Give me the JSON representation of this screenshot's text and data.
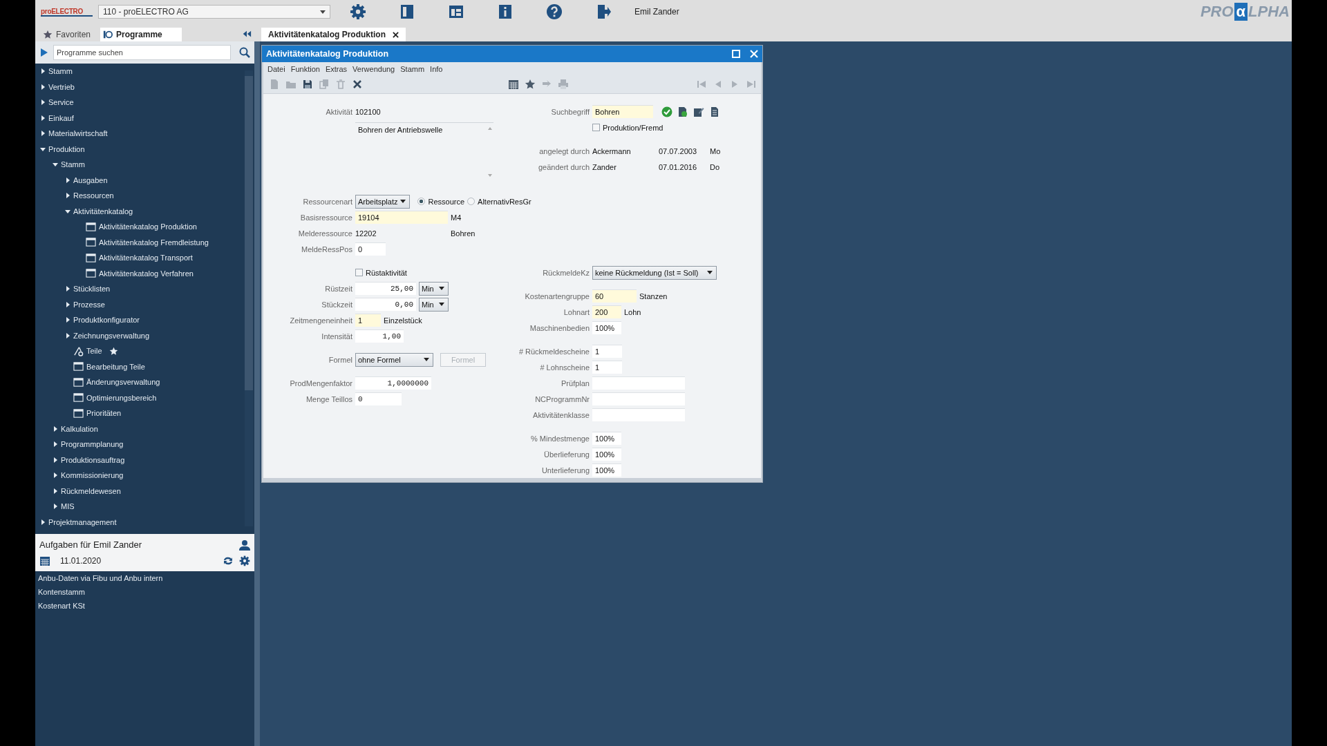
{
  "top_bar": {
    "logo": "proELECTRO",
    "company": "110 - proELECTRO AG",
    "user": "Emil Zander",
    "brand": {
      "prefix": "PRO",
      "mark": "α",
      "suffix": "LPHA"
    }
  },
  "sidebar": {
    "tabs": [
      {
        "label": "Favoriten",
        "selected": false
      },
      {
        "label": "Programme",
        "selected": true
      }
    ],
    "search": {
      "placeholder": "Programme suchen"
    },
    "tree": [
      {
        "label": "Stamm",
        "kind": "folder",
        "expanded": false
      },
      {
        "label": "Vertrieb",
        "kind": "folder",
        "expanded": false
      },
      {
        "label": "Service",
        "kind": "folder",
        "expanded": false
      },
      {
        "label": "Einkauf",
        "kind": "folder",
        "expanded": false
      },
      {
        "label": "Materialwirtschaft",
        "kind": "folder",
        "expanded": false
      },
      {
        "label": "Produktion",
        "kind": "folder",
        "expanded": true,
        "children": [
          {
            "label": "Stamm",
            "kind": "folder",
            "expanded": true,
            "children": [
              {
                "label": "Ausgaben",
                "kind": "folder",
                "expanded": false
              },
              {
                "label": "Ressourcen",
                "kind": "folder",
                "expanded": false
              },
              {
                "label": "Aktivitätenkatalog",
                "kind": "folder",
                "expanded": true,
                "children": [
                  {
                    "label": "Aktivitätenkatalog Produktion",
                    "kind": "program",
                    "favorite": false
                  },
                  {
                    "label": "Aktivitätenkatalog Fremdleistung",
                    "kind": "program",
                    "favorite": false
                  },
                  {
                    "label": "Aktivitätenkatalog Transport",
                    "kind": "program",
                    "favorite": false
                  },
                  {
                    "label": "Aktivitätenkatalog Verfahren",
                    "kind": "program",
                    "favorite": false
                  }
                ]
              },
              {
                "label": "Stücklisten",
                "kind": "folder",
                "expanded": false
              },
              {
                "label": "Prozesse",
                "kind": "folder",
                "expanded": false
              },
              {
                "label": "Produktkonfigurator",
                "kind": "folder",
                "expanded": false
              },
              {
                "label": "Zeichnungsverwaltung",
                "kind": "folder",
                "expanded": false
              },
              {
                "label": "Teile",
                "kind": "tool",
                "favorite": true
              },
              {
                "label": "Bearbeitung Teile",
                "kind": "program",
                "favorite": false
              },
              {
                "label": "Änderungsverwaltung",
                "kind": "program",
                "favorite": false
              },
              {
                "label": "Optimierungsbereich",
                "kind": "program",
                "favorite": false
              },
              {
                "label": "Prioritäten",
                "kind": "program",
                "favorite": false
              }
            ]
          },
          {
            "label": "Kalkulation",
            "kind": "folder",
            "expanded": false
          },
          {
            "label": "Programmplanung",
            "kind": "folder",
            "expanded": false
          },
          {
            "label": "Produktionsauftrag",
            "kind": "folder",
            "expanded": false
          },
          {
            "label": "Kommissionierung",
            "kind": "folder",
            "expanded": false
          },
          {
            "label": "Rückmeldewesen",
            "kind": "folder",
            "expanded": false
          },
          {
            "label": "MIS",
            "kind": "folder",
            "expanded": false
          }
        ]
      },
      {
        "label": "Projektmanagement",
        "kind": "folder",
        "expanded": false
      }
    ],
    "tasks": {
      "title": "Aufgaben für Emil Zander",
      "date": "11.01.2020",
      "items": [
        "Anbu-Daten via Fibu und Anbu intern",
        "Kontenstamm",
        "Kostenart KSt"
      ]
    }
  },
  "document_tabs": [
    {
      "label": "Aktivitätenkatalog Produktion",
      "selected": true
    }
  ],
  "window": {
    "title": "Aktivitätenkatalog Produktion",
    "menu": [
      "Datei",
      "Funktion",
      "Extras",
      "Verwendung",
      "Stamm",
      "Info"
    ],
    "form": {
      "header_left": [
        [
          {
            "label": "Aktivität",
            "controls": [
              {
                "kind": "text",
                "value": "102100"
              }
            ]
          },
          {
            "controls": [
              {
                "kind": "memo",
                "value": "Bohren der Antriebswelle"
              }
            ]
          }
        ]
      ],
      "header_right": [
        [
          {
            "label": "Suchbegriff",
            "controls": [
              {
                "kind": "field",
                "value": "Bohren",
                "highlighted": true
              }
            ]
          },
          {
            "controls": [
              {
                "kind": "checkbox",
                "label": "Produktion/Fremd",
                "checked": false
              }
            ]
          }
        ],
        [
          {
            "label": "angelegt durch",
            "controls": [
              {
                "kind": "text",
                "value": "Ackermann"
              },
              {
                "kind": "text",
                "value": "07.07.2003"
              },
              {
                "kind": "text",
                "value": "Mo"
              }
            ]
          },
          {
            "label": "geändert durch",
            "controls": [
              {
                "kind": "text",
                "value": "Zander"
              },
              {
                "kind": "text",
                "value": "07.01.2016"
              },
              {
                "kind": "text",
                "value": "Do"
              }
            ]
          }
        ]
      ],
      "resource": [
        [
          {
            "label": "Ressourcenart",
            "controls": [
              {
                "kind": "select",
                "value": "Arbeitsplatz"
              },
              {
                "kind": "radio",
                "label": "Ressource",
                "selected": true
              },
              {
                "kind": "radio",
                "label": "AlternativResGr",
                "selected": false
              }
            ]
          },
          {
            "label": "Basisressource",
            "controls": [
              {
                "kind": "field",
                "value": "19104",
                "highlighted": true
              },
              {
                "kind": "text",
                "value": "M4"
              }
            ]
          },
          {
            "label": "Melderessource",
            "controls": [
              {
                "kind": "text",
                "value": "12202"
              },
              {
                "kind": "text",
                "value": "Bohren"
              }
            ]
          },
          {
            "label": "MeldeRessPos",
            "controls": [
              {
                "kind": "field",
                "value": "0",
                "highlighted": false
              }
            ]
          }
        ]
      ],
      "left": [
        [
          {
            "controls": [
              {
                "kind": "checkbox",
                "label": "Rüstaktivität",
                "checked": false
              }
            ]
          },
          {
            "label": "Rüstzeit",
            "controls": [
              {
                "kind": "field",
                "value": "25,00",
                "highlighted": false
              },
              {
                "kind": "select",
                "value": "Min"
              }
            ]
          },
          {
            "label": "Stückzeit",
            "controls": [
              {
                "kind": "field",
                "value": "0,00",
                "highlighted": false
              },
              {
                "kind": "select",
                "value": "Min"
              }
            ]
          },
          {
            "label": "Zeitmengeneinheit",
            "controls": [
              {
                "kind": "field",
                "value": "1",
                "highlighted": true
              },
              {
                "kind": "text",
                "value": "Einzelstück"
              }
            ]
          },
          {
            "label": "Intensität",
            "controls": [
              {
                "kind": "field",
                "value": "1,00",
                "highlighted": false
              }
            ]
          }
        ],
        [
          {
            "label": "Formel",
            "controls": [
              {
                "kind": "select",
                "value": "ohne Formel"
              },
              {
                "kind": "button",
                "label": "Formel",
                "disabled": true
              }
            ]
          }
        ],
        [
          {
            "label": "ProdMengenfaktor",
            "controls": [
              {
                "kind": "field",
                "value": "1,0000000",
                "highlighted": false
              }
            ]
          },
          {
            "label": "Menge Teillos",
            "controls": [
              {
                "kind": "field",
                "value": "0",
                "highlighted": false
              }
            ]
          }
        ]
      ],
      "right": [
        [
          {
            "label": "RückmeldeKz",
            "controls": [
              {
                "kind": "select",
                "value": "keine Rückmeldung (Ist = Soll)"
              }
            ]
          }
        ],
        [
          {
            "label": "Kostenartengruppe",
            "controls": [
              {
                "kind": "field",
                "value": "60",
                "highlighted": true
              },
              {
                "kind": "text",
                "value": "Stanzen"
              }
            ]
          },
          {
            "label": "Lohnart",
            "controls": [
              {
                "kind": "field",
                "value": "200",
                "highlighted": true
              },
              {
                "kind": "text",
                "value": "Lohn"
              }
            ]
          },
          {
            "label": "Maschinenbedien",
            "controls": [
              {
                "kind": "field",
                "value": "100%",
                "highlighted": false
              }
            ]
          }
        ],
        [
          {
            "label": "# Rückmeldescheine",
            "controls": [
              {
                "kind": "field",
                "value": "1",
                "highlighted": false
              }
            ]
          },
          {
            "label": "# Lohnscheine",
            "controls": [
              {
                "kind": "field",
                "value": "1",
                "highlighted": false
              }
            ]
          },
          {
            "label": "Prüfplan",
            "controls": [
              {
                "kind": "field",
                "highlighted": false
              }
            ]
          },
          {
            "label": "NCProgrammNr",
            "controls": [
              {
                "kind": "field",
                "highlighted": false
              }
            ]
          },
          {
            "label": "Aktivitätenklasse",
            "controls": [
              {
                "kind": "field",
                "highlighted": false
              }
            ]
          }
        ],
        [
          {
            "label": "% Mindestmenge",
            "controls": [
              {
                "kind": "field",
                "value": "100%",
                "highlighted": false
              }
            ]
          },
          {
            "label": "Überlieferung",
            "controls": [
              {
                "kind": "field",
                "value": "100%",
                "highlighted": false
              }
            ]
          },
          {
            "label": "Unterlieferung",
            "controls": [
              {
                "kind": "field",
                "value": "100%",
                "highlighted": false
              }
            ]
          }
        ]
      ]
    }
  }
}
